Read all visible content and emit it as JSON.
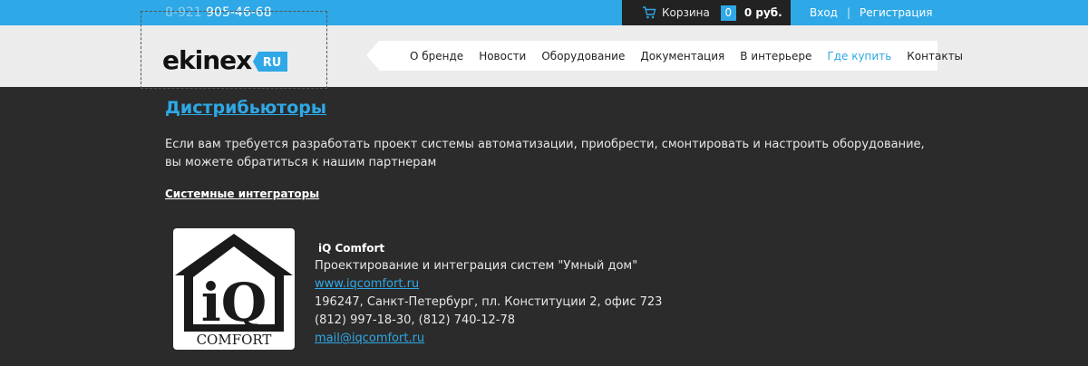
{
  "topbar": {
    "phone_prefix": "8-921",
    "phone_number": "905-46-68",
    "cart_label": "Корзина",
    "cart_count": "0",
    "cart_total": "0 руб.",
    "login": "Вход",
    "separator": "|",
    "register": "Регистрация"
  },
  "header": {
    "logo_text": "ekinex",
    "logo_badge": "RU",
    "nav": [
      {
        "label": "О бренде"
      },
      {
        "label": "Новости"
      },
      {
        "label": "Оборудование"
      },
      {
        "label": "Документация"
      },
      {
        "label": "В интерьере"
      },
      {
        "label": "Где купить"
      },
      {
        "label": "Контакты"
      }
    ],
    "active_nav": "Где купить"
  },
  "main": {
    "title": "Дистрибьюторы",
    "intro": "Если вам требуется разработать проект системы автоматизации, приобрести, смонтировать и настроить оборудование, вы можете обратиться к нашим партнерам",
    "section_title": "Системные интеграторы",
    "company": {
      "logo_text_main": "iQ",
      "logo_text_sub": "COMFORT",
      "name": "iQ Comfort",
      "description": "Проектирование и интеграция систем \"Умный дом\"",
      "website": "www.iqcomfort.ru",
      "address": "196247, Санкт-Петербург, пл. Конституции 2, офис 723",
      "phones": "(812) 997-18-30, (812) 740-12-78",
      "email": "mail@iqcomfort.ru"
    }
  },
  "colors": {
    "accent": "#2ea8e6",
    "background": "#2b2b2b",
    "header_bg": "#ececec"
  }
}
